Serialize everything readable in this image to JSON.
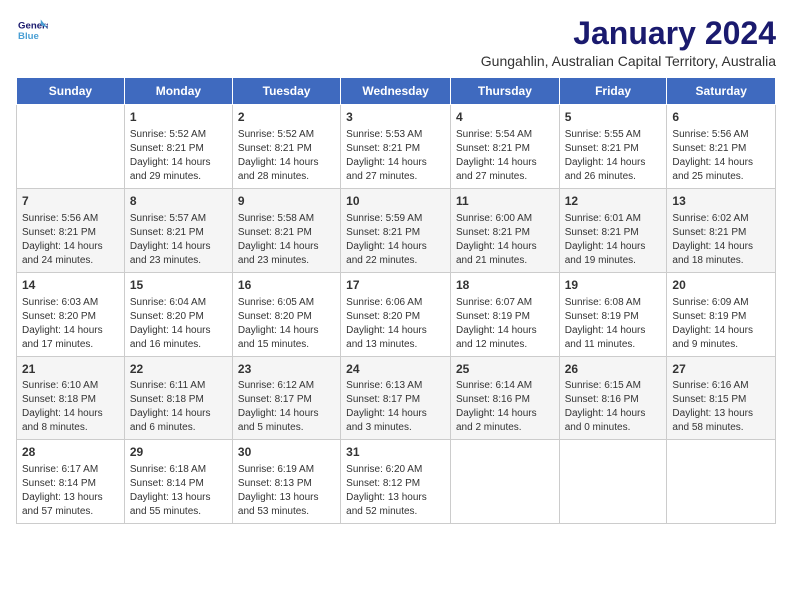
{
  "header": {
    "logo_line1": "General",
    "logo_line2": "Blue",
    "title": "January 2024",
    "subtitle": "Gungahlin, Australian Capital Territory, Australia"
  },
  "weekdays": [
    "Sunday",
    "Monday",
    "Tuesday",
    "Wednesday",
    "Thursday",
    "Friday",
    "Saturday"
  ],
  "weeks": [
    [
      {
        "day": "",
        "info": ""
      },
      {
        "day": "1",
        "info": "Sunrise: 5:52 AM\nSunset: 8:21 PM\nDaylight: 14 hours\nand 29 minutes."
      },
      {
        "day": "2",
        "info": "Sunrise: 5:52 AM\nSunset: 8:21 PM\nDaylight: 14 hours\nand 28 minutes."
      },
      {
        "day": "3",
        "info": "Sunrise: 5:53 AM\nSunset: 8:21 PM\nDaylight: 14 hours\nand 27 minutes."
      },
      {
        "day": "4",
        "info": "Sunrise: 5:54 AM\nSunset: 8:21 PM\nDaylight: 14 hours\nand 27 minutes."
      },
      {
        "day": "5",
        "info": "Sunrise: 5:55 AM\nSunset: 8:21 PM\nDaylight: 14 hours\nand 26 minutes."
      },
      {
        "day": "6",
        "info": "Sunrise: 5:56 AM\nSunset: 8:21 PM\nDaylight: 14 hours\nand 25 minutes."
      }
    ],
    [
      {
        "day": "7",
        "info": "Sunrise: 5:56 AM\nSunset: 8:21 PM\nDaylight: 14 hours\nand 24 minutes."
      },
      {
        "day": "8",
        "info": "Sunrise: 5:57 AM\nSunset: 8:21 PM\nDaylight: 14 hours\nand 23 minutes."
      },
      {
        "day": "9",
        "info": "Sunrise: 5:58 AM\nSunset: 8:21 PM\nDaylight: 14 hours\nand 23 minutes."
      },
      {
        "day": "10",
        "info": "Sunrise: 5:59 AM\nSunset: 8:21 PM\nDaylight: 14 hours\nand 22 minutes."
      },
      {
        "day": "11",
        "info": "Sunrise: 6:00 AM\nSunset: 8:21 PM\nDaylight: 14 hours\nand 21 minutes."
      },
      {
        "day": "12",
        "info": "Sunrise: 6:01 AM\nSunset: 8:21 PM\nDaylight: 14 hours\nand 19 minutes."
      },
      {
        "day": "13",
        "info": "Sunrise: 6:02 AM\nSunset: 8:21 PM\nDaylight: 14 hours\nand 18 minutes."
      }
    ],
    [
      {
        "day": "14",
        "info": "Sunrise: 6:03 AM\nSunset: 8:20 PM\nDaylight: 14 hours\nand 17 minutes."
      },
      {
        "day": "15",
        "info": "Sunrise: 6:04 AM\nSunset: 8:20 PM\nDaylight: 14 hours\nand 16 minutes."
      },
      {
        "day": "16",
        "info": "Sunrise: 6:05 AM\nSunset: 8:20 PM\nDaylight: 14 hours\nand 15 minutes."
      },
      {
        "day": "17",
        "info": "Sunrise: 6:06 AM\nSunset: 8:20 PM\nDaylight: 14 hours\nand 13 minutes."
      },
      {
        "day": "18",
        "info": "Sunrise: 6:07 AM\nSunset: 8:19 PM\nDaylight: 14 hours\nand 12 minutes."
      },
      {
        "day": "19",
        "info": "Sunrise: 6:08 AM\nSunset: 8:19 PM\nDaylight: 14 hours\nand 11 minutes."
      },
      {
        "day": "20",
        "info": "Sunrise: 6:09 AM\nSunset: 8:19 PM\nDaylight: 14 hours\nand 9 minutes."
      }
    ],
    [
      {
        "day": "21",
        "info": "Sunrise: 6:10 AM\nSunset: 8:18 PM\nDaylight: 14 hours\nand 8 minutes."
      },
      {
        "day": "22",
        "info": "Sunrise: 6:11 AM\nSunset: 8:18 PM\nDaylight: 14 hours\nand 6 minutes."
      },
      {
        "day": "23",
        "info": "Sunrise: 6:12 AM\nSunset: 8:17 PM\nDaylight: 14 hours\nand 5 minutes."
      },
      {
        "day": "24",
        "info": "Sunrise: 6:13 AM\nSunset: 8:17 PM\nDaylight: 14 hours\nand 3 minutes."
      },
      {
        "day": "25",
        "info": "Sunrise: 6:14 AM\nSunset: 8:16 PM\nDaylight: 14 hours\nand 2 minutes."
      },
      {
        "day": "26",
        "info": "Sunrise: 6:15 AM\nSunset: 8:16 PM\nDaylight: 14 hours\nand 0 minutes."
      },
      {
        "day": "27",
        "info": "Sunrise: 6:16 AM\nSunset: 8:15 PM\nDaylight: 13 hours\nand 58 minutes."
      }
    ],
    [
      {
        "day": "28",
        "info": "Sunrise: 6:17 AM\nSunset: 8:14 PM\nDaylight: 13 hours\nand 57 minutes."
      },
      {
        "day": "29",
        "info": "Sunrise: 6:18 AM\nSunset: 8:14 PM\nDaylight: 13 hours\nand 55 minutes."
      },
      {
        "day": "30",
        "info": "Sunrise: 6:19 AM\nSunset: 8:13 PM\nDaylight: 13 hours\nand 53 minutes."
      },
      {
        "day": "31",
        "info": "Sunrise: 6:20 AM\nSunset: 8:12 PM\nDaylight: 13 hours\nand 52 minutes."
      },
      {
        "day": "",
        "info": ""
      },
      {
        "day": "",
        "info": ""
      },
      {
        "day": "",
        "info": ""
      }
    ]
  ]
}
